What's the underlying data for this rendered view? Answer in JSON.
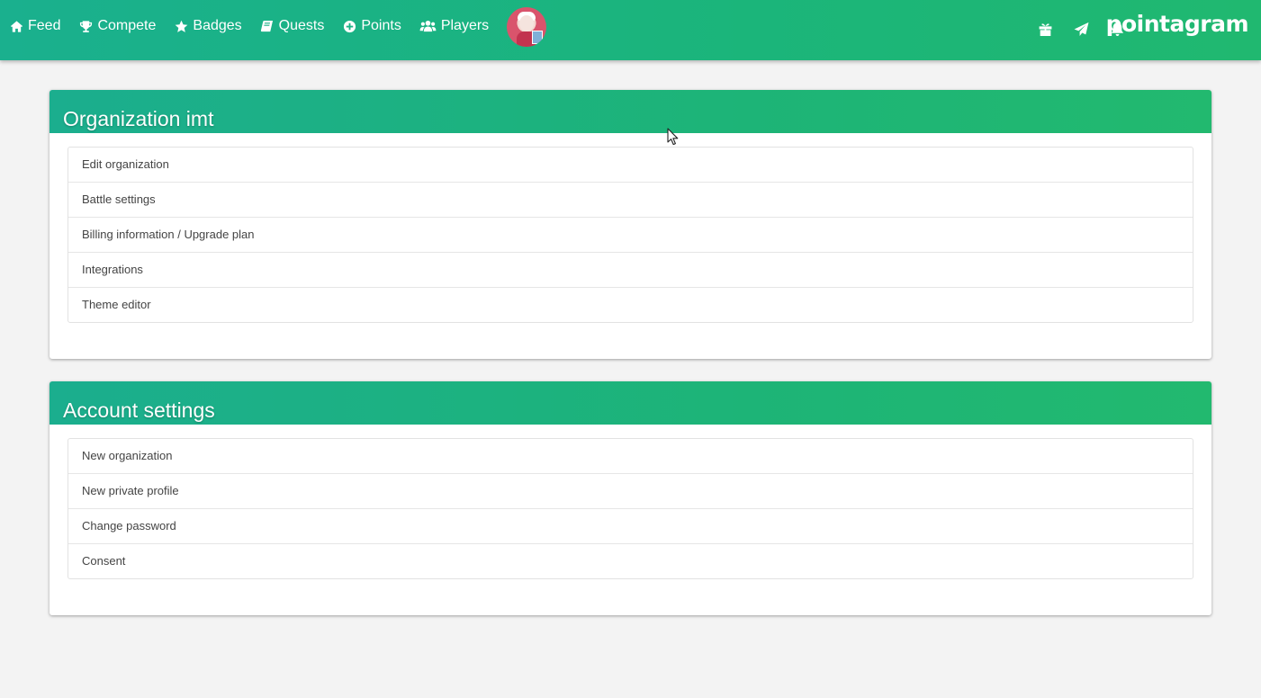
{
  "nav": {
    "items": [
      {
        "label": "Feed",
        "icon": "home-icon"
      },
      {
        "label": "Compete",
        "icon": "trophy-icon"
      },
      {
        "label": "Badges",
        "icon": "star-icon"
      },
      {
        "label": "Quests",
        "icon": "book-icon"
      },
      {
        "label": "Points",
        "icon": "plus-circle-icon"
      },
      {
        "label": "Players",
        "icon": "users-icon"
      }
    ],
    "right_icons": [
      "gift-icon",
      "send-icon",
      "bell-icon"
    ],
    "logo": "pointagram"
  },
  "organization_card": {
    "title": "Organization imt",
    "items": [
      "Edit organization",
      "Battle settings",
      "Billing information / Upgrade plan",
      "Integrations",
      "Theme editor"
    ]
  },
  "account_card": {
    "title": "Account settings",
    "items": [
      "New organization",
      "New private profile",
      "Change password",
      "Consent"
    ]
  },
  "colors": {
    "header_green": "#1bb57a",
    "header_teal": "#1ab08e",
    "background": "#f3f3f3"
  }
}
